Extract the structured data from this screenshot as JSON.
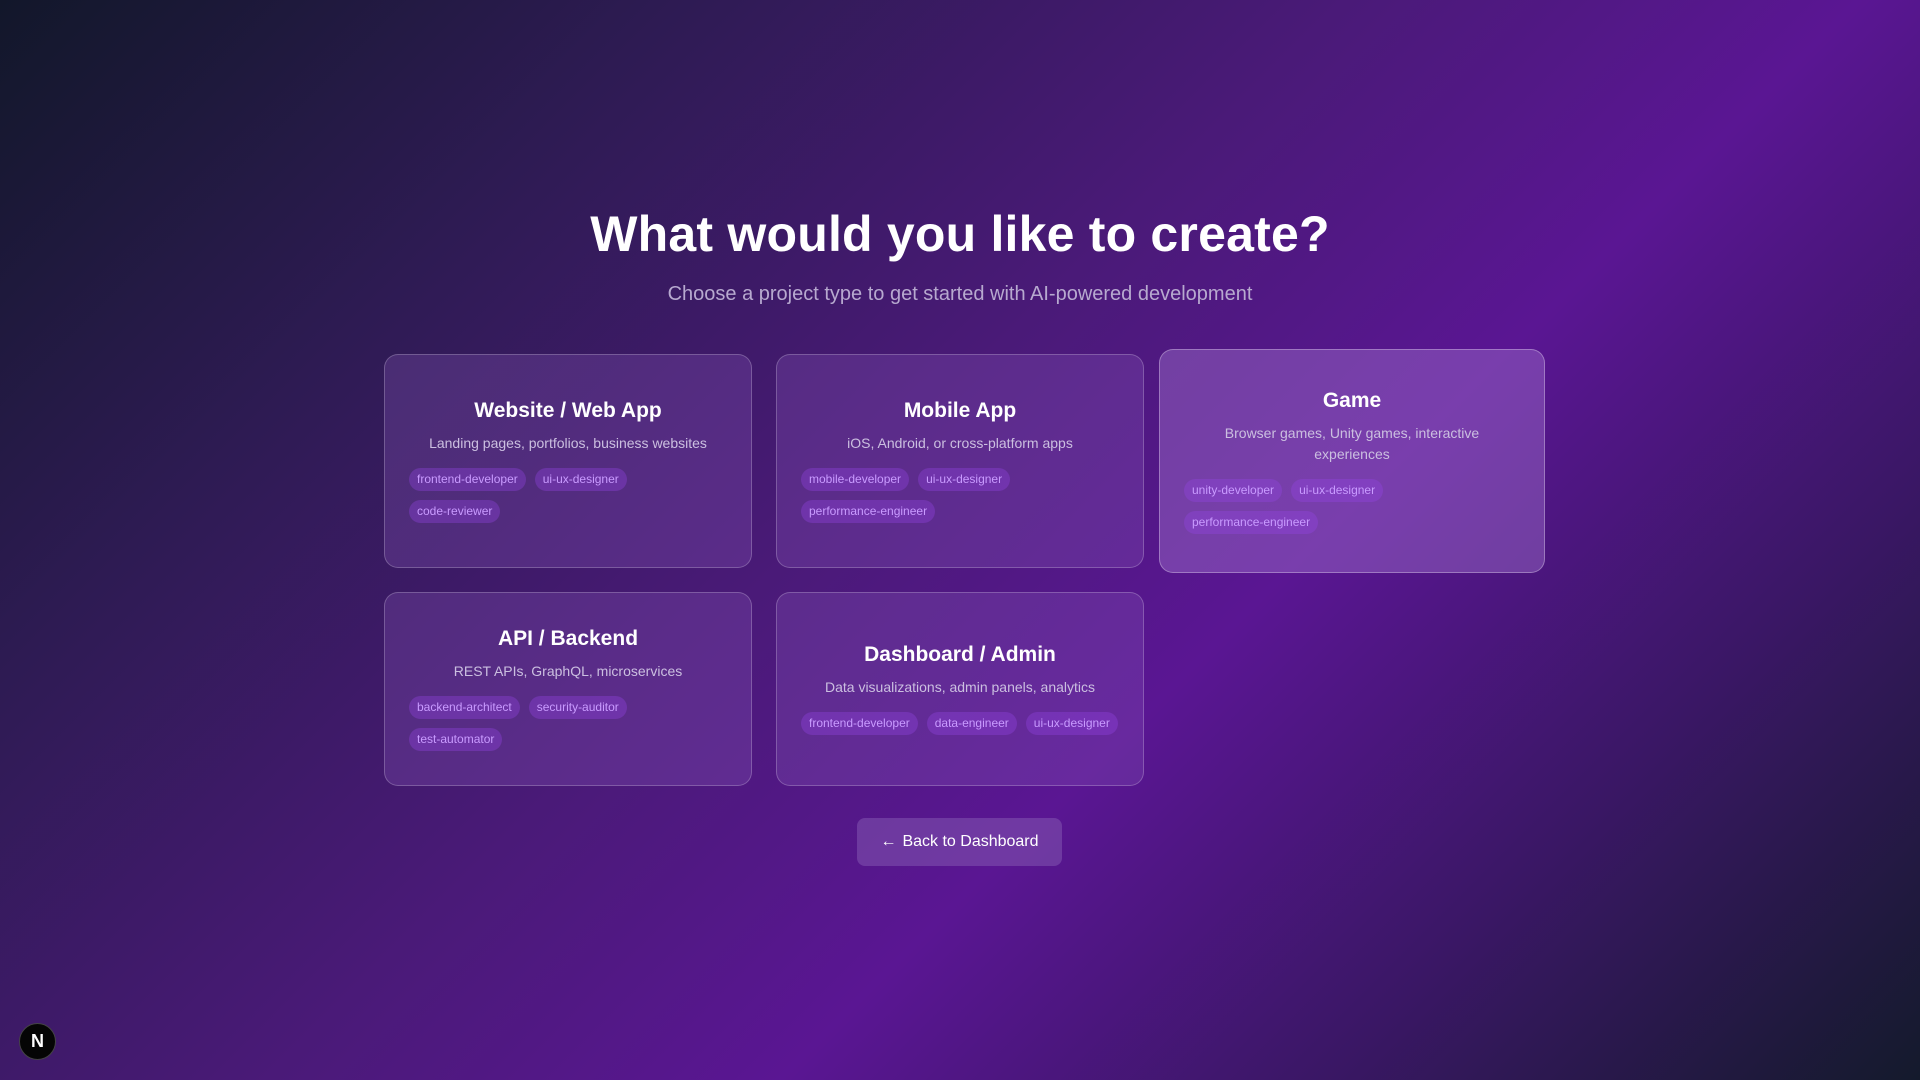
{
  "header": {
    "title": "What would you like to create?",
    "subtitle": "Choose a project type to get started with AI-powered development"
  },
  "cards": [
    {
      "title": "Website / Web App",
      "description": "Landing pages, portfolios, business websites",
      "tags": [
        "frontend-developer",
        "ui-ux-designer",
        "code-reviewer"
      ]
    },
    {
      "title": "Mobile App",
      "description": "iOS, Android, or cross-platform apps",
      "tags": [
        "mobile-developer",
        "ui-ux-designer",
        "performance-engineer"
      ]
    },
    {
      "title": "Game",
      "description": "Browser games, Unity games, interactive experiences",
      "tags": [
        "unity-developer",
        "ui-ux-designer",
        "performance-engineer"
      ]
    },
    {
      "title": "API / Backend",
      "description": "REST APIs, GraphQL, microservices",
      "tags": [
        "backend-architect",
        "security-auditor",
        "test-automator"
      ]
    },
    {
      "title": "Dashboard / Admin",
      "description": "Data visualizations, admin panels, analytics",
      "tags": [
        "frontend-developer",
        "data-engineer",
        "ui-ux-designer"
      ]
    }
  ],
  "back_button": {
    "arrow": "←",
    "label": "Back to Dashboard"
  },
  "dev_badge": {
    "letter": "N"
  },
  "colors": {
    "tag_text": "#c99bff",
    "accent_purple": "#5a1693"
  }
}
